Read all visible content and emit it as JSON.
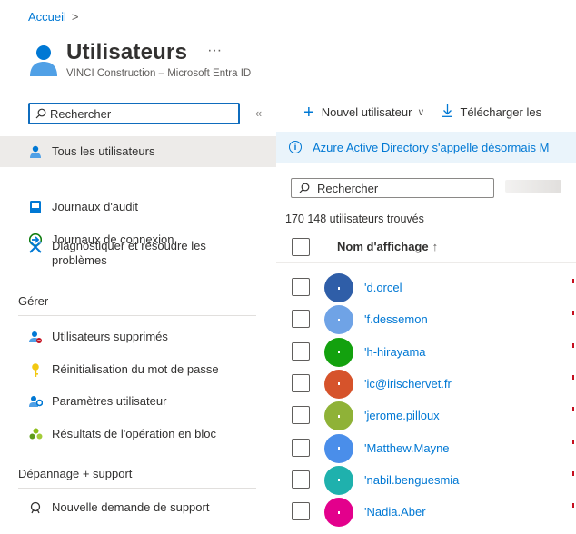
{
  "breadcrumb": {
    "home": "Accueil",
    "sep": ">"
  },
  "header": {
    "title": "Utilisateurs",
    "ellipsis": "···",
    "subtitle": "VINCI Construction – Microsoft Entra ID"
  },
  "sidebar": {
    "search_placeholder": "Rechercher",
    "collapse": "«",
    "items": [
      {
        "label": "Tous les utilisateurs",
        "icon": "users-icon"
      },
      {
        "label": "Journaux d'audit",
        "icon": "audit-log-icon"
      },
      {
        "label": "Journaux de connexion",
        "icon": "sign-in-log-icon"
      },
      {
        "label_line1": "Diagnostiquer et résoudre les",
        "label_line2": "problèmes",
        "icon": "wrench-icon"
      }
    ],
    "section_manage": "Gérer",
    "manage_items": [
      {
        "label": "Utilisateurs supprimés",
        "icon": "deleted-user-icon"
      },
      {
        "label": "Réinitialisation du mot de passe",
        "icon": "key-icon"
      },
      {
        "label": "Paramètres utilisateur",
        "icon": "user-settings-icon"
      },
      {
        "label": "Résultats de l'opération en bloc",
        "icon": "bulk-results-icon"
      }
    ],
    "section_support": "Dépannage + support",
    "support_items": [
      {
        "label": "Nouvelle demande de support",
        "icon": "support-icon"
      }
    ]
  },
  "toolbar": {
    "new_user": "Nouvel utilisateur",
    "chevron": "∨",
    "download": "Télécharger les"
  },
  "banner": {
    "text": "Azure Active Directory s'appelle désormais M"
  },
  "main": {
    "search_placeholder": "Rechercher",
    "count": "170 148 utilisateurs trouvés",
    "col_display_name": "Nom d'affichage",
    "sort_arrow": "↑"
  },
  "users": [
    {
      "name": "'d.orcel",
      "color": "#2f5ea8"
    },
    {
      "name": "'f.dessemon",
      "color": "#6fa3e6"
    },
    {
      "name": "'h-hirayama",
      "color": "#13a10e"
    },
    {
      "name": "'ic@irischervet.fr",
      "color": "#d6532b"
    },
    {
      "name": "'jerome.pilloux",
      "color": "#8fb237"
    },
    {
      "name": "'Matthew.Mayne",
      "color": "#4a8eea"
    },
    {
      "name": "'nabil.benguesmia",
      "color": "#1fb1ad"
    },
    {
      "name": "'Nadia.Aber",
      "color": "#e3008c"
    }
  ]
}
